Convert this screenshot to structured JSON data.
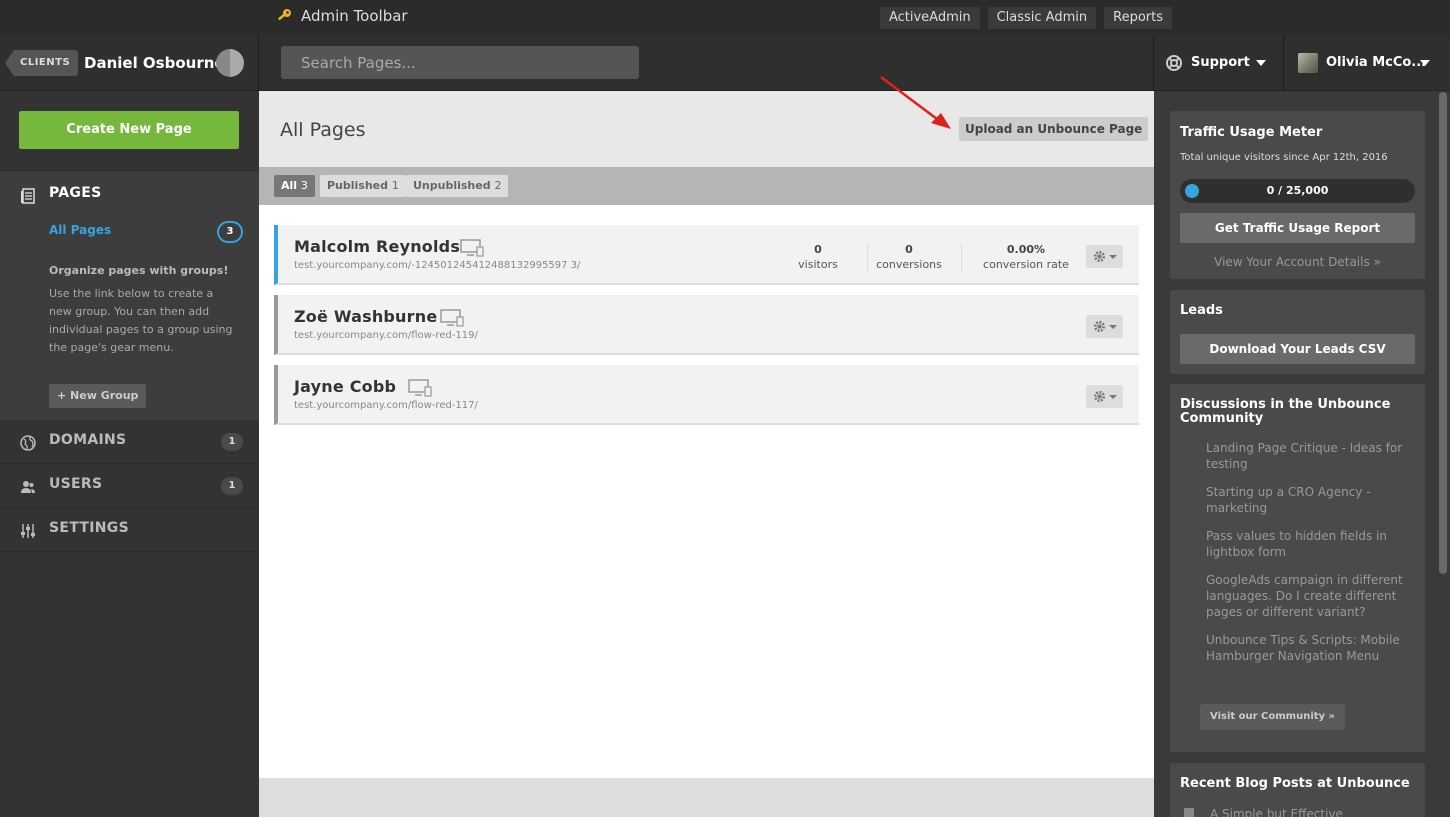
{
  "admin_bar": {
    "title": "Admin Toolbar",
    "links": [
      "ActiveAdmin",
      "Classic Admin",
      "Reports"
    ]
  },
  "header": {
    "clients_label": "CLIENTS",
    "client_name": "Daniel Osbourne",
    "search_placeholder": "Search Pages...",
    "support_label": "Support",
    "user_label": "Olivia McCo..."
  },
  "sidebar": {
    "create_button": "Create New Page",
    "pages_label": "PAGES",
    "all_pages_link": "All Pages",
    "all_pages_count": "3",
    "org_title": "Organize pages with groups!",
    "org_body": "Use the link below to create a new group. You can then add individual pages to a group using the page's gear menu.",
    "new_group_button": "+ New Group",
    "nav": [
      {
        "label": "DOMAINS",
        "count": "1"
      },
      {
        "label": "USERS",
        "count": "1"
      },
      {
        "label": "SETTINGS",
        "count": ""
      }
    ]
  },
  "main": {
    "title": "All Pages",
    "upload_button": "Upload an Unbounce Page",
    "filters": [
      {
        "label": "All",
        "count": "3"
      },
      {
        "label": "Published",
        "count": "1"
      },
      {
        "label": "Unpublished",
        "count": "2"
      }
    ],
    "pages": [
      {
        "name": "Malcolm Reynolds",
        "url": "test.yourcompany.com/-124501245412488132995597 3/",
        "stats": [
          {
            "value": "0",
            "label": "visitors"
          },
          {
            "value": "0",
            "label": "conversions"
          },
          {
            "value": "0.00%",
            "label": "conversion rate"
          }
        ]
      },
      {
        "name": "Zoë Washburne",
        "url": "test.yourcompany.com/flow-red-119/"
      },
      {
        "name": "Jayne Cobb",
        "url": "test.yourcompany.com/flow-red-117/"
      }
    ]
  },
  "right": {
    "traffic": {
      "title": "Traffic Usage Meter",
      "subtitle": "Total unique visitors since Apr 12th, 2016",
      "meter_text": "0 / 25,000",
      "meter_fraction": 0,
      "report_button": "Get Traffic Usage Report",
      "account_link": "View Your Account Details »"
    },
    "leads": {
      "title": "Leads",
      "button": "Download Your Leads CSV"
    },
    "discussions": {
      "title": "Discussions in the Unbounce Community",
      "items": [
        "Landing Page Critique - Ideas for testing",
        "Starting up a CRO Agency - marketing",
        "Pass values to hidden fields in lightbox form",
        "GoogleAds campaign in different languages. Do I create different pages or different variant?",
        "Unbounce Tips & Scripts: Mobile Hamburger Navigation Menu"
      ],
      "community_button": "Visit our Community »"
    },
    "blog": {
      "title": "Recent Blog Posts at Unbounce",
      "first_item": "A Simple but Effective"
    }
  },
  "colors": {
    "accent_green": "#76b83b",
    "accent_blue": "#36a3e0",
    "arrow_red": "#e0201b"
  }
}
